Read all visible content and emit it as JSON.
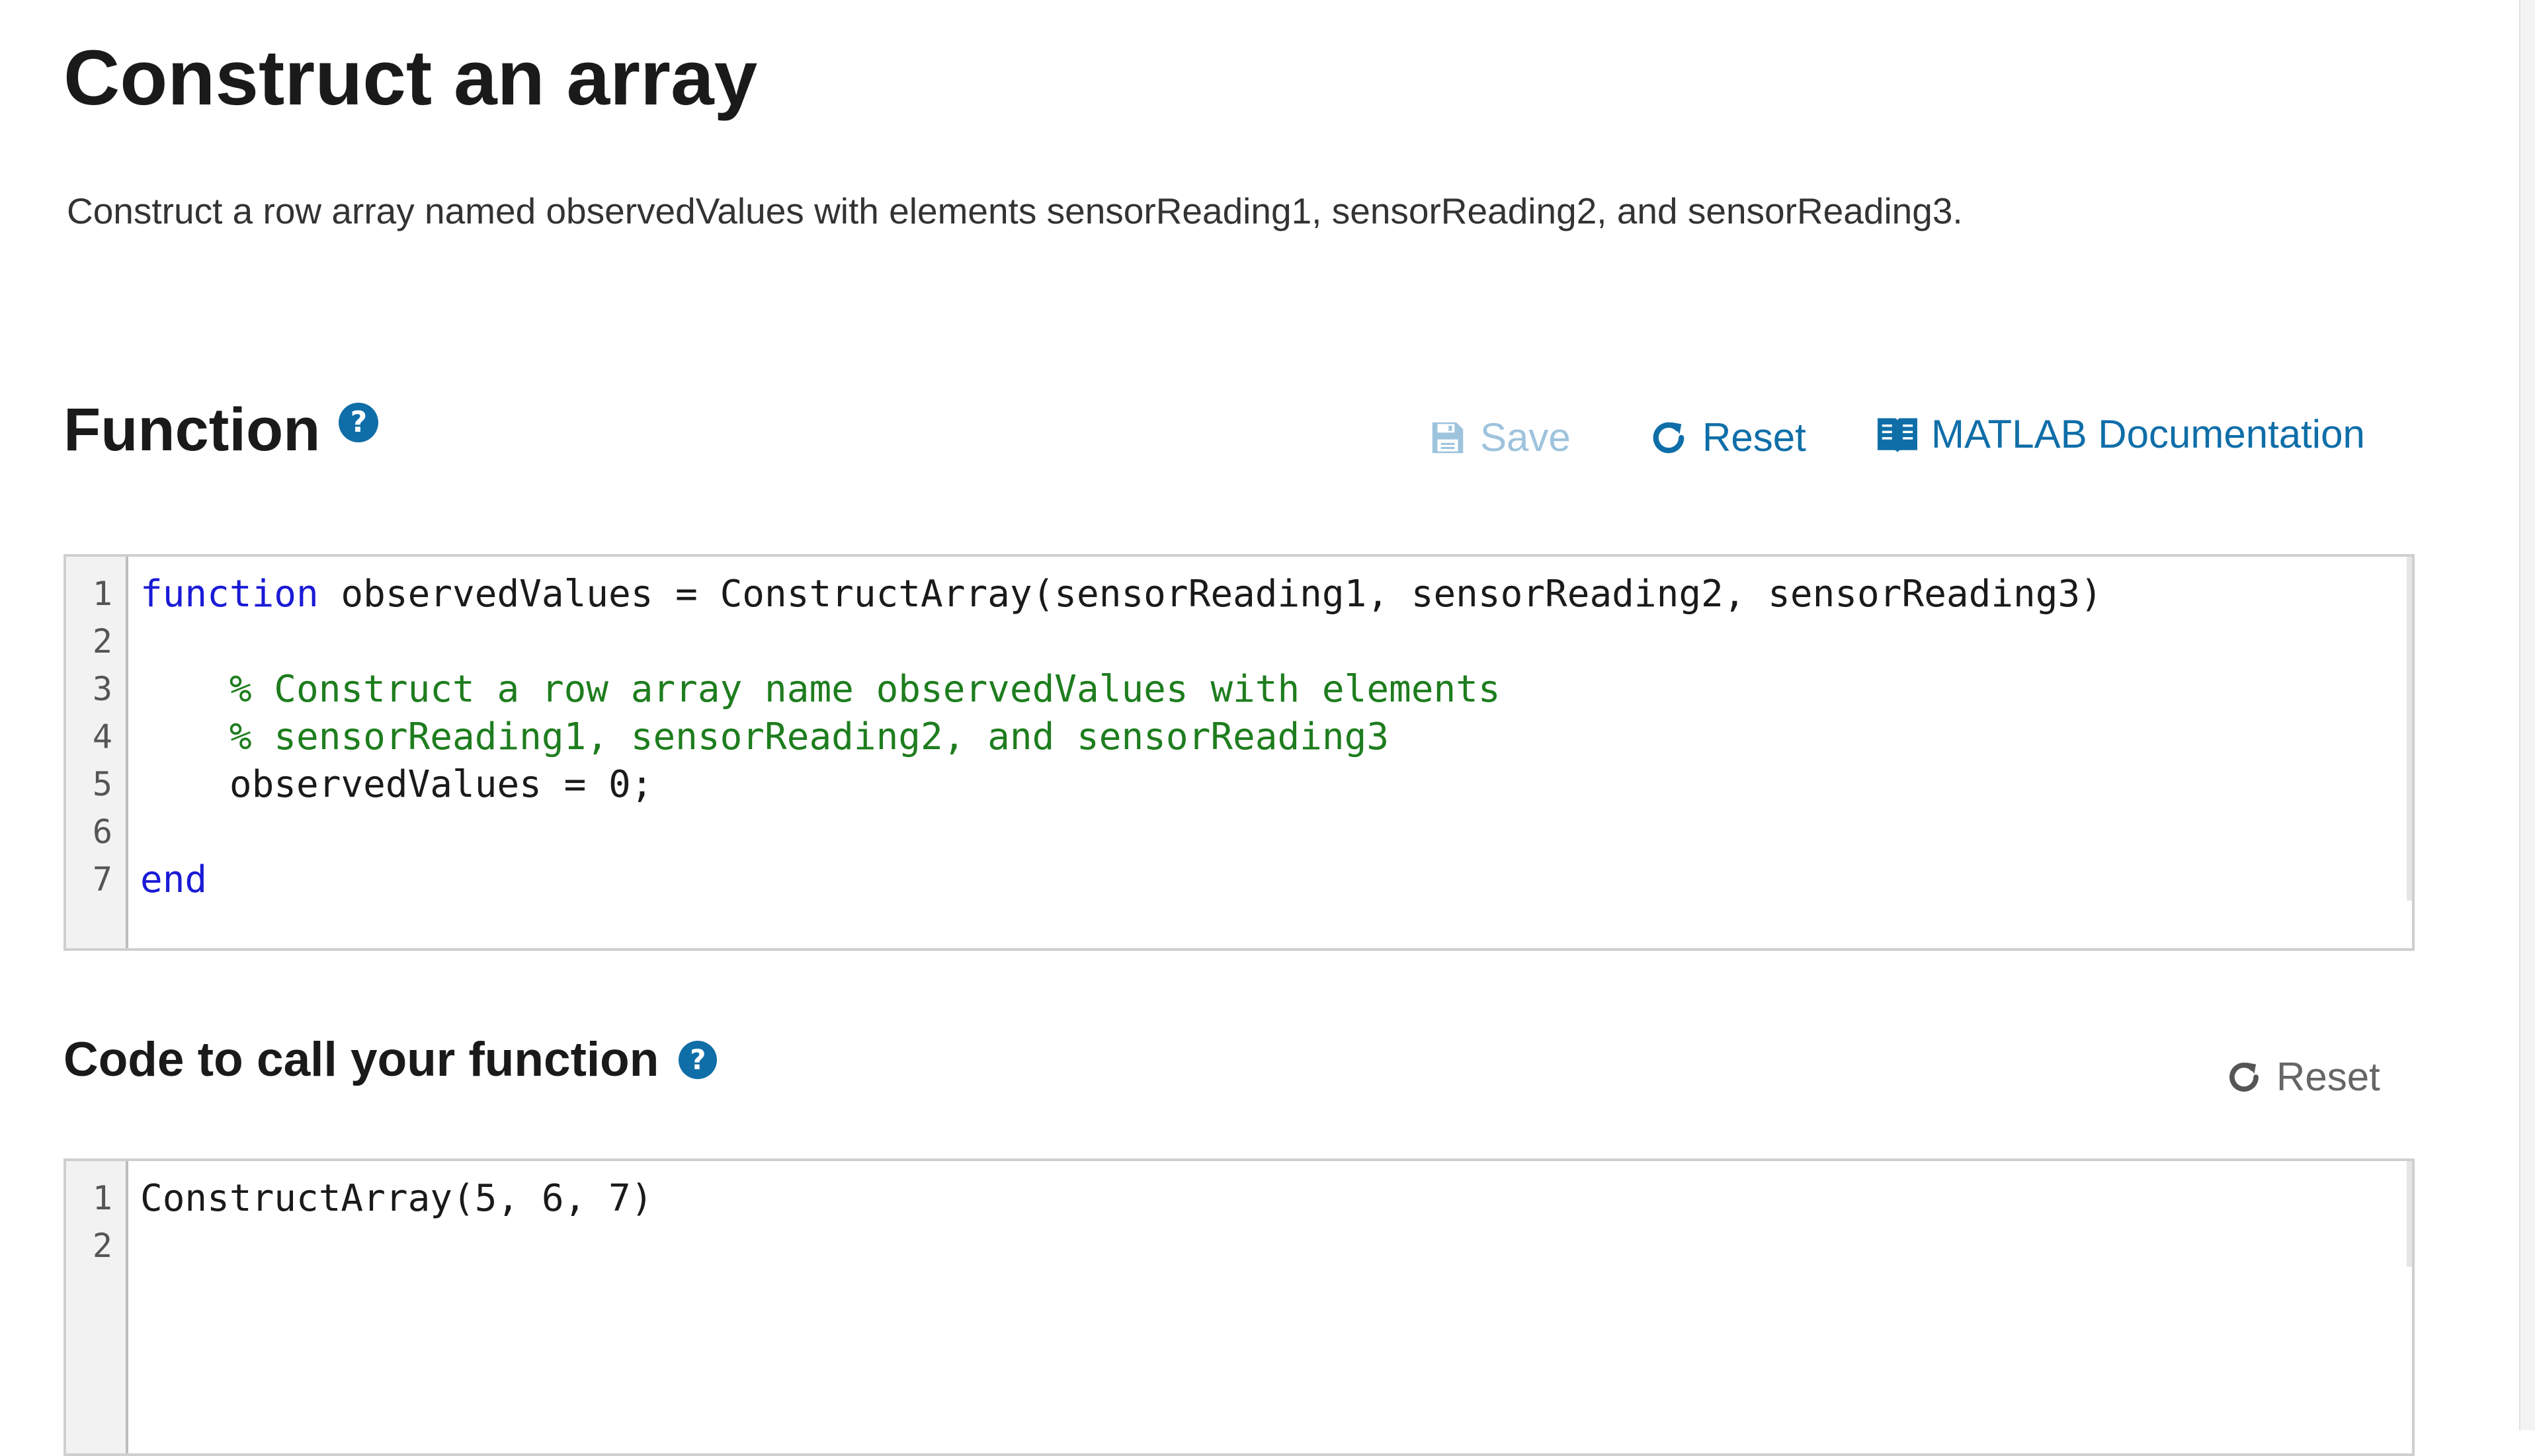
{
  "page": {
    "title": "Construct an array",
    "description": "Construct a row array named observedValues with elements sensorReading1, sensorReading2, and sensorReading3."
  },
  "function_section": {
    "title": "Function",
    "help_icon": "question-circle-icon",
    "toolbar": {
      "save_label": "Save",
      "save_icon": "floppy-disk-icon",
      "reset_label": "Reset",
      "reset_icon": "refresh-icon",
      "docs_label": "MATLAB Documentation",
      "docs_icon": "book-icon"
    },
    "code_lines": [
      {
        "number": "1",
        "keyword": "function",
        "code": " observedValues = ConstructArray(sensorReading1, sensorReading2, sensorReading3)",
        "comment": ""
      },
      {
        "number": "2",
        "keyword": "",
        "code": "",
        "comment": ""
      },
      {
        "number": "3",
        "keyword": "",
        "code": "    ",
        "comment": "% Construct a row array name observedValues with elements"
      },
      {
        "number": "4",
        "keyword": "",
        "code": "    ",
        "comment": "% sensorReading1, sensorReading2, and sensorReading3"
      },
      {
        "number": "5",
        "keyword": "",
        "code": "    observedValues = 0;",
        "comment": ""
      },
      {
        "number": "6",
        "keyword": "",
        "code": "",
        "comment": ""
      },
      {
        "number": "7",
        "keyword": "end",
        "code": "",
        "comment": ""
      }
    ]
  },
  "caller_section": {
    "title": "Code to call your function",
    "help_icon": "question-circle-icon",
    "reset_label": "Reset",
    "reset_icon": "refresh-icon",
    "code_lines": [
      {
        "number": "1",
        "code": "ConstructArray(5, 6, 7)"
      },
      {
        "number": "2",
        "code": ""
      }
    ]
  },
  "colors": {
    "accent": "#0f6ea8",
    "save_disabled": "#9ec3dd",
    "keyword": "#1a1ad6",
    "comment": "#1e7d1e"
  }
}
